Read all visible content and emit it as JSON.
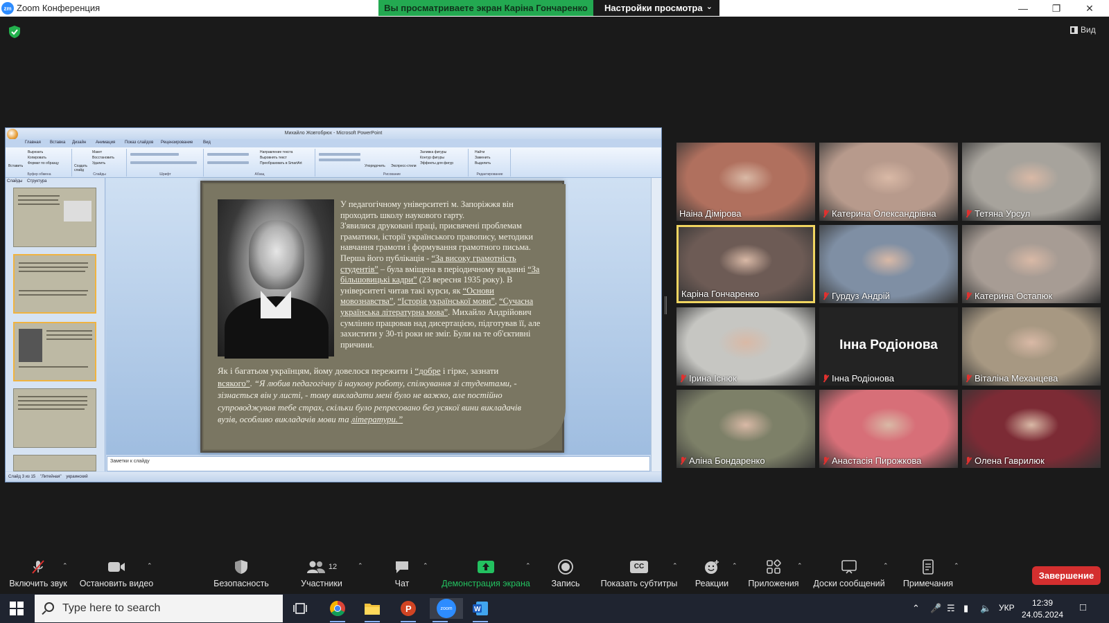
{
  "window": {
    "title": "Zoom Конференция",
    "share_banner": "Вы просматриваете экран Каріна Гончаренко",
    "view_settings": "Настройки просмотра",
    "view_button": "Вид"
  },
  "powerpoint": {
    "title": "Михайло Жовтобрюх - Microsoft PowerPoint",
    "tabs": [
      "Главная",
      "Вставка",
      "Дизайн",
      "Анимация",
      "Показ слайдов",
      "Рецензирование",
      "Вид"
    ],
    "sidebar_tabs": [
      "Слайды",
      "Структура"
    ],
    "ribbon_groups": [
      "Буфер обмена",
      "Слайды",
      "Шрифт",
      "Абзац",
      "Рисование",
      "Редактирование"
    ],
    "clipboard_items": [
      "Вырезать",
      "Копировать",
      "Формат по образцу"
    ],
    "paste_label": "Вставить",
    "slides_items": [
      "Макет",
      "Восстановить",
      "Удалить"
    ],
    "create_slide": "Создать слайд",
    "paragraph_items": [
      "Направление текста",
      "Выровнять текст",
      "Преобразовать в SmartArt"
    ],
    "drawing_items": [
      "Упорядочить",
      "Экспресс-стили",
      "Заливка фигуры",
      "Контур фигуры",
      "Эффекты для фигур"
    ],
    "editing_items": [
      "Найти",
      "Заменить",
      "Выделить"
    ],
    "notes_placeholder": "Заметки к слайду",
    "status": [
      "Слайд 3 из 15",
      "\"Литейная\"",
      "украинский"
    ],
    "slide": {
      "para1": "У педагогічному університеті м. Запоріжжя він проходить школу наукового гарту.",
      "para2": "З'явилися друковані праці, присвячені проблемам граматики, історії українського правопису, методики навчання грамоти і формування грамотного письма.",
      "para3_a": "Перша його публікація - ",
      "para3_link1": "“За високу грамотність студентів”",
      "para3_b": " – була вміщена в періодичному виданні ",
      "para3_link2": "“За більшовицькі кадри”",
      "para3_c": " (23 вересня 1935 року). В університеті читав такі курси, як ",
      "para3_link3": "“Основи мовознавства”",
      "para3_d": ", ",
      "para3_link4": "“Історія української мови”",
      "para3_e": ", ",
      "para3_link5": "“Сучасна українська літературна мова”",
      "para3_f": ". Михайло Андрійович сумлінно працював над дисертацією, підготував її, але захистити у 30-ті роки не зміг. Були на те об'єктивні причини.",
      "quote_a": "Як і багатьом українцям, йому довелося пережити і ",
      "quote_link1": "“добре",
      "quote_b": " і гірке, зазнати ",
      "quote_link2": "всякого”",
      "quote_c": ". ",
      "quote_italic": "“Я любив педагогічну й наукову роботу, спілкування зі студентами, - зізнається він у листі, - тому викладати мені було не важко, але постійно супроводжував тебе страх, скільки було репресовано без усякої вини викладачів вузів, особливо викладачів мови та ",
      "quote_link3": "літератури.”"
    }
  },
  "participants": [
    {
      "name": "Наіна Дімірова",
      "muted": false,
      "active": false,
      "bg": "#b0705e"
    },
    {
      "name": "Катерина Олександрівна",
      "muted": true,
      "active": false,
      "bg": "#b79a8c"
    },
    {
      "name": "Тетяна Урсул",
      "muted": true,
      "active": false,
      "bg": "#a7a39c"
    },
    {
      "name": "Каріна Гончаренко",
      "muted": false,
      "active": true,
      "bg": "#6d5b55"
    },
    {
      "name": "Гурдуз Андрій",
      "muted": true,
      "active": false,
      "bg": "#7f8fa4"
    },
    {
      "name": "Катерина Остапюк",
      "muted": true,
      "active": false,
      "bg": "#a79c94"
    },
    {
      "name": "Ірина Існюк",
      "muted": true,
      "active": false,
      "bg": "#c6c6c2"
    },
    {
      "name": "Інна Родіонова",
      "muted": true,
      "active": false,
      "bg": "#232323",
      "display_name": "Інна Родіонова"
    },
    {
      "name": "Віталіна Механцева",
      "muted": true,
      "active": false,
      "bg": "#a79882"
    },
    {
      "name": "Аліна Бондаренко",
      "muted": true,
      "active": false,
      "bg": "#7d8068"
    },
    {
      "name": "Анастасія Пирожкова",
      "muted": true,
      "active": false,
      "bg": "#d76f78"
    },
    {
      "name": "Олена Гаврилюк",
      "muted": true,
      "active": false,
      "bg": "#7c2b35"
    }
  ],
  "toolbar": {
    "unmute": "Включить звук",
    "stop_video": "Остановить видео",
    "security": "Безопасность",
    "participants": "Участники",
    "participants_count": "12",
    "chat": "Чат",
    "share_screen": "Демонстрация экрана",
    "record": "Запись",
    "captions": "Показать субтитры",
    "captions_badge": "CC",
    "reactions": "Реакции",
    "apps": "Приложения",
    "whiteboards": "Доски сообщений",
    "notes": "Примечания",
    "end": "Завершение"
  },
  "taskbar": {
    "search_placeholder": "Type here to search",
    "zoom_label": "zoom",
    "language": "УКР",
    "time": "12:39",
    "date": "24.05.2024"
  },
  "colors": {
    "share_green": "#23a951",
    "end_red": "#d42f2f",
    "active_speaker": "#f0d560",
    "mute_red": "#e0312f"
  }
}
